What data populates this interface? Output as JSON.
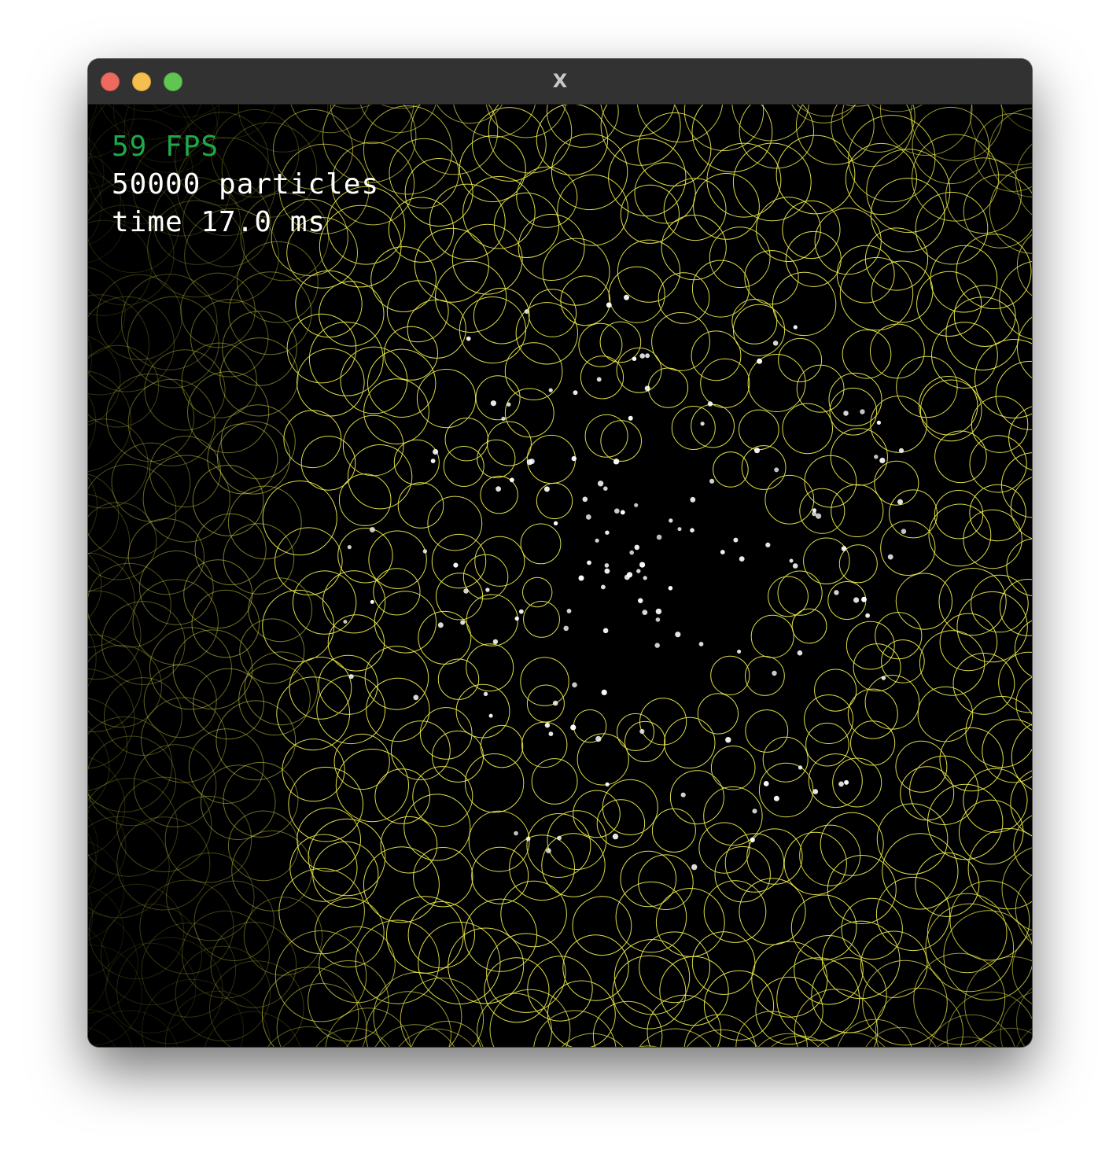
{
  "window": {
    "title": "X"
  },
  "overlay": {
    "fps": "59 FPS",
    "particles": "50000 particles",
    "time": "time 17.0 ms"
  },
  "colors": {
    "fps": "#1ea84a",
    "stat_text": "#ffffff",
    "ring": "#e8e84a",
    "particle": "#ffffff",
    "titlebar": "#323232",
    "canvas": "#000000"
  }
}
